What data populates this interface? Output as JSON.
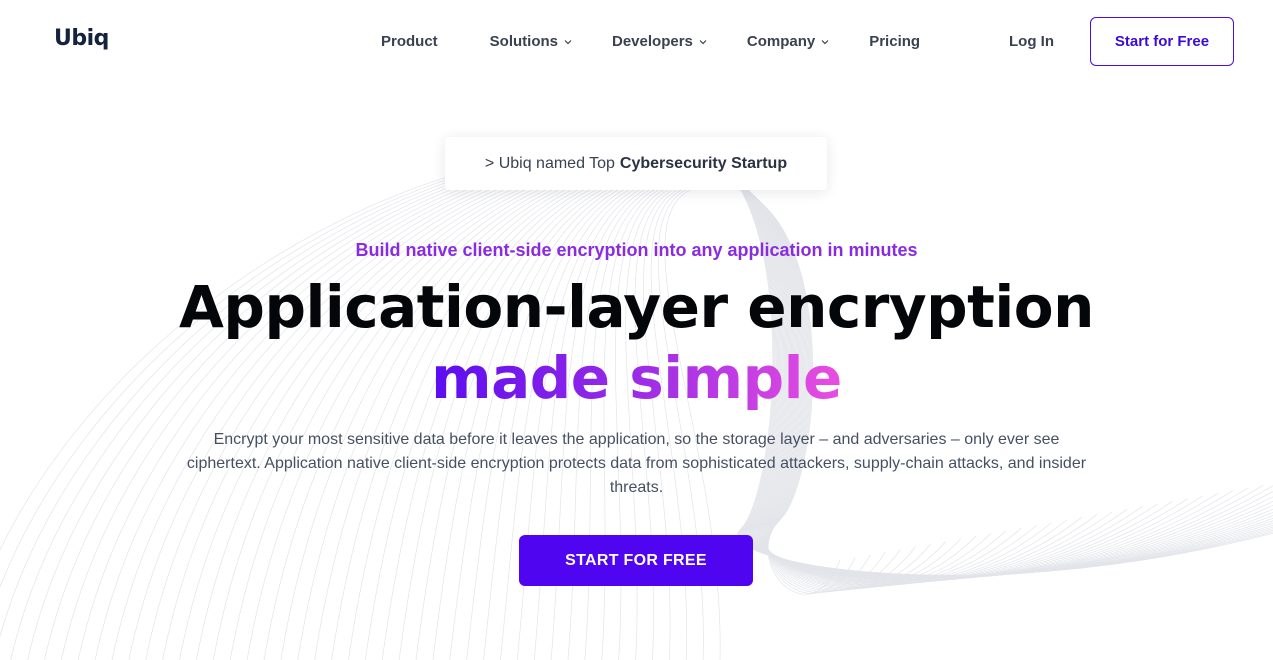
{
  "brand": {
    "logo_text": "Ubiq"
  },
  "nav": {
    "items": [
      {
        "label": "Product",
        "has_dropdown": false
      },
      {
        "label": "Solutions",
        "has_dropdown": true
      },
      {
        "label": "Developers",
        "has_dropdown": true
      },
      {
        "label": "Company",
        "has_dropdown": true
      },
      {
        "label": "Pricing",
        "has_dropdown": false
      }
    ],
    "login_label": "Log In",
    "start_label": "Start for Free"
  },
  "announcement": {
    "prefix": "> Ubiq named Top",
    "highlight": "Cybersecurity Startup"
  },
  "hero": {
    "eyebrow": "Build native client-side encryption into any application in minutes",
    "headline_line1": "Application-layer encryption",
    "headline_line2": "made simple",
    "description": "Encrypt your most sensitive data before it leaves the application, so the storage layer – and adversaries – only ever see ciphertext. Application native client-side encryption protects data from sophisticated attackers, supply-chain attacks, and insider threats.",
    "cta_label": "START FOR FREE"
  },
  "colors": {
    "accent": "#4f05ef",
    "eyebrow": "#8a2be2",
    "gradient_start": "#5b0cf0",
    "gradient_end": "#ea4ee0",
    "logo": "#13233f"
  }
}
